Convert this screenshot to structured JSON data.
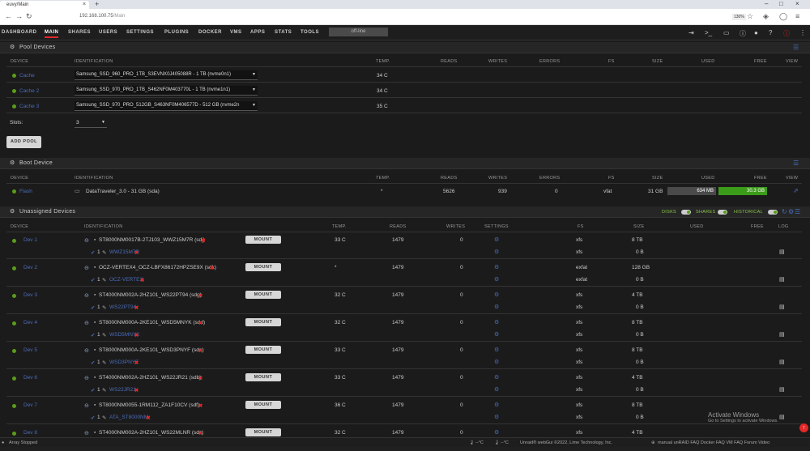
{
  "browser": {
    "tab_title": "euvy/Main",
    "url_host": "192.168.100.75",
    "url_path": "/Main",
    "zoom": "130%"
  },
  "nav": {
    "items": [
      "DASHBOARD",
      "MAIN",
      "SHARES",
      "USERS",
      "SETTINGS",
      "PLUGINS",
      "DOCKER",
      "VMS",
      "APPS",
      "STATS",
      "TOOLS"
    ],
    "active": "MAIN",
    "status": "off-line"
  },
  "pool": {
    "title": "Pool Devices",
    "columns": [
      "DEVICE",
      "IDENTIFICATION",
      "TEMP.",
      "READS",
      "WRITES",
      "ERRORS",
      "FS",
      "SIZE",
      "USED",
      "FREE",
      "VIEW"
    ],
    "rows": [
      {
        "device": "Cache",
        "id": "Samsung_SSD_960_PRO_1TB_S3EVNX0J405088R - 1 TB (nvme0n1)",
        "temp": "34 C"
      },
      {
        "device": "Cache 2",
        "id": "Samsung_SSD_970_PRO_1TB_S462NF0M403770L - 1 TB (nvme1n1)",
        "temp": "34 C"
      },
      {
        "device": "Cache 3",
        "id": "Samsung_SSD_970_PRO_512GB_S463NF0M406577D - 512 GB (nvme2n",
        "temp": "35 C"
      }
    ],
    "slots_label": "Slots:",
    "slots_value": "3",
    "add_pool": "ADD POOL"
  },
  "boot": {
    "title": "Boot Device",
    "columns": [
      "DEVICE",
      "IDENTIFICATION",
      "TEMP.",
      "READS",
      "WRITES",
      "ERRORS",
      "FS",
      "SIZE",
      "USED",
      "FREE",
      "VIEW"
    ],
    "row": {
      "device": "Flash",
      "id": "DataTraveler_3.0 - 31 GB (sda)",
      "temp": "*",
      "reads": "5626",
      "writes": "939",
      "errors": "0",
      "fs": "vfat",
      "size": "31 GB",
      "used": "634 MB",
      "free": "30.3 GB"
    },
    "used_fraction": 0.02
  },
  "unassigned": {
    "title": "Unassigned Devices",
    "toggles": [
      "DISKS",
      "SHARES",
      "HISTORICAL"
    ],
    "columns": [
      "DEVICE",
      "IDENTIFICATION",
      "TEMP.",
      "READS",
      "WRITES",
      "SETTINGS",
      "FS",
      "SIZE",
      "USED",
      "FREE",
      "LOG"
    ],
    "mount_label": "MOUNT",
    "rows": [
      {
        "device": "Dev 1",
        "id": "ST8000NM0017B-2TJ103_WWZ15M7R (sdj)",
        "part": "WWZ15M7R",
        "temp": "33 C",
        "reads": "1479",
        "writes": "0",
        "fs": "xfs",
        "size": "8 TB",
        "psize": "0 B"
      },
      {
        "device": "Dev 2",
        "id": "OCZ-VERTEX4_OCZ-LBFX86172HPZSE9X (sdk)",
        "part": "OCZ-VERTEX",
        "temp": "*",
        "reads": "1479",
        "writes": "0",
        "fs": "exfat",
        "size": "128 GB",
        "psize": "0 B"
      },
      {
        "device": "Dev 3",
        "id": "ST4000NM002A-2HZ101_WS22PT94 (sdg)",
        "part": "WS22PT94",
        "temp": "32 C",
        "reads": "1479",
        "writes": "0",
        "fs": "xfs",
        "size": "4 TB",
        "psize": "0 B"
      },
      {
        "device": "Dev 4",
        "id": "ST8000NM000A-2KE101_WSD5MNYK (sdd)",
        "part": "WSD5MNYK",
        "temp": "32 C",
        "reads": "1479",
        "writes": "0",
        "fs": "xfs",
        "size": "8 TB",
        "psize": "0 B"
      },
      {
        "device": "Dev 5",
        "id": "ST8000NM000A-2KE101_WSD3PNYF (sde)",
        "part": "WSD3PNYF",
        "temp": "33 C",
        "reads": "1479",
        "writes": "0",
        "fs": "xfs",
        "size": "8 TB",
        "psize": "0 B"
      },
      {
        "device": "Dev 6",
        "id": "ST4000NM002A-2HZ101_WS22JR21 (sdb)",
        "part": "WS22JR21",
        "temp": "33 C",
        "reads": "1479",
        "writes": "0",
        "fs": "xfs",
        "size": "4 TB",
        "psize": "0 B"
      },
      {
        "device": "Dev 7",
        "id": "ST8000NM0055-1RM112_ZA1F10CV (sdf)",
        "part": "ATA_ST8000NM",
        "temp": "36 C",
        "reads": "1479",
        "writes": "0",
        "fs": "xfs",
        "size": "8 TB",
        "psize": "0 B"
      },
      {
        "device": "Dev 8",
        "id": "ST4000NM002A-2HZ101_WS22MLNR (sdc)",
        "part": "",
        "temp": "32 C",
        "reads": "1479",
        "writes": "0",
        "fs": "xfs",
        "size": "4 TB",
        "psize": ""
      }
    ]
  },
  "status": {
    "array": "Array Stopped",
    "temp1": "--°C",
    "temp2": "--°C",
    "copyright": "Unraid® webGui ©2022, Lime Technology, Inc.",
    "links": "manual   unRAID FAQ   Docker FAQ   VM FAQ   Forum   Video"
  },
  "watermark": {
    "line1": "Activate Windows",
    "line2": "Go to Settings to activate Windows."
  }
}
